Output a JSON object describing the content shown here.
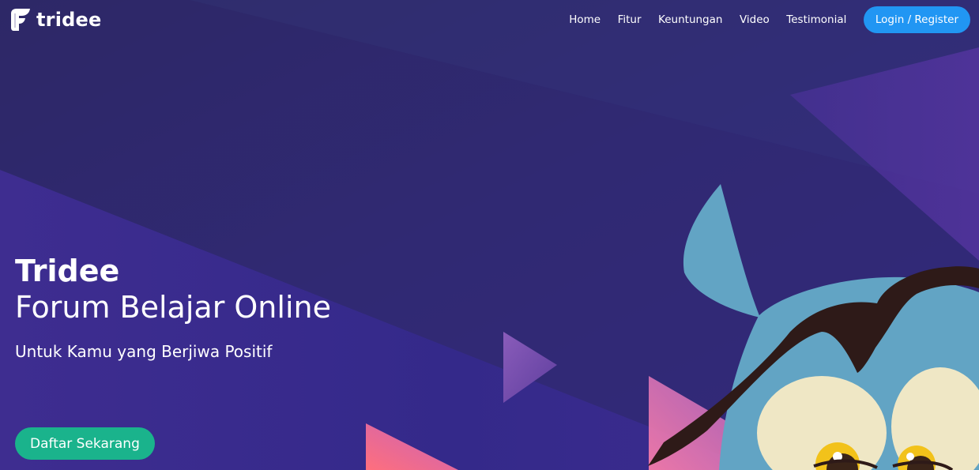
{
  "brand": {
    "name": "tridee"
  },
  "nav": {
    "items": [
      {
        "label": "Home"
      },
      {
        "label": "Fitur"
      },
      {
        "label": "Keuntungan"
      },
      {
        "label": "Video"
      },
      {
        "label": "Testimonial"
      }
    ],
    "login_label": "Login / Register"
  },
  "hero": {
    "title": "Tridee",
    "subtitle": "Forum Belajar Online",
    "tagline": "Untuk Kamu yang Berjiwa Positif",
    "cta_label": "Daftar Sekarang"
  },
  "colors": {
    "background": "#35297c",
    "login_button": "#2196f3",
    "cta_button": "#1ab38c",
    "mascot_body": "#62a4c4",
    "mascot_hair": "#2e1a18"
  }
}
